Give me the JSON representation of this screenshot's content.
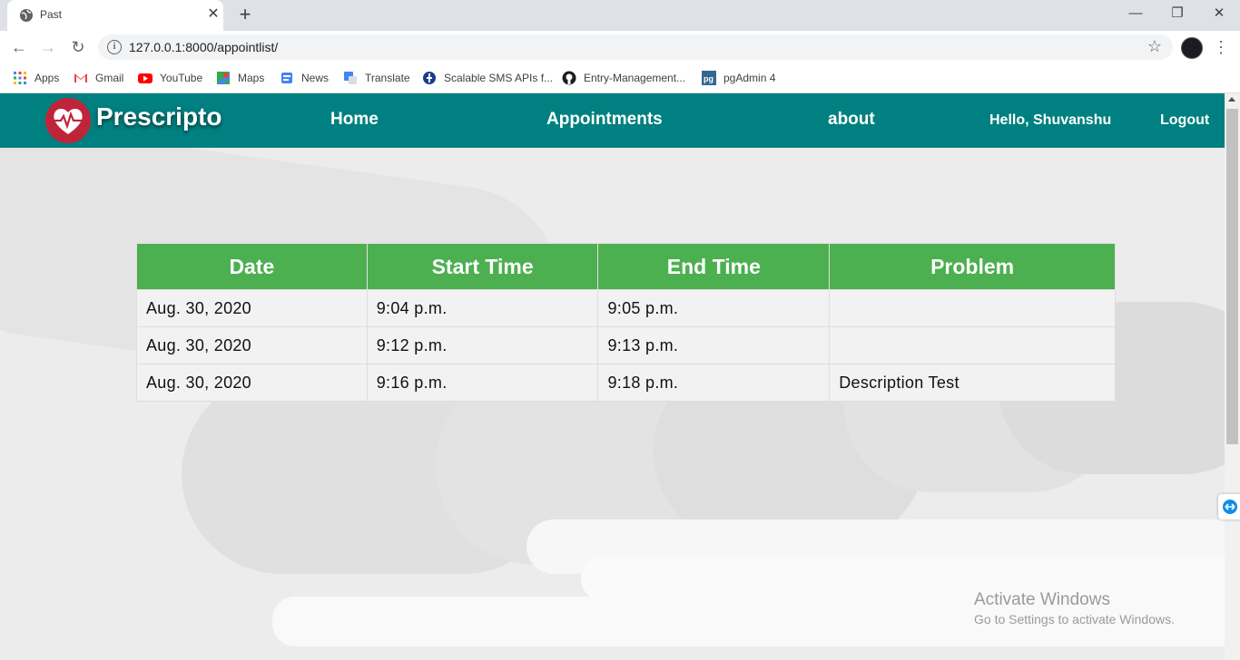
{
  "browser": {
    "tab_title": "Past",
    "url": "127.0.0.1:8000/appointlist/",
    "window_controls": {
      "minimize": "—",
      "restore": "❐",
      "close": "✕"
    },
    "bookmarks": [
      {
        "label": "Apps",
        "icon": "apps-grid-icon"
      },
      {
        "label": "Gmail",
        "icon": "gmail-icon"
      },
      {
        "label": "YouTube",
        "icon": "youtube-icon"
      },
      {
        "label": "Maps",
        "icon": "maps-icon"
      },
      {
        "label": "News",
        "icon": "news-icon"
      },
      {
        "label": "Translate",
        "icon": "translate-icon"
      },
      {
        "label": "Scalable SMS APIs f...",
        "icon": "twilio-icon"
      },
      {
        "label": "Entry-Management...",
        "icon": "github-icon"
      },
      {
        "label": "pgAdmin 4",
        "icon": "pgadmin-icon"
      }
    ]
  },
  "nav": {
    "brand": "Prescripto",
    "links": [
      "Home",
      "Appointments",
      "about"
    ],
    "greeting": "Hello, Shuvanshu",
    "logout": "Logout",
    "colors": {
      "bar": "#008080",
      "logo": "#c0243a"
    }
  },
  "table": {
    "headers": [
      "Date",
      "Start Time",
      "End Time",
      "Problem"
    ],
    "rows": [
      [
        "Aug. 30, 2020",
        "9:04 p.m.",
        "9:05 p.m.",
        ""
      ],
      [
        "Aug. 30, 2020",
        "9:12 p.m.",
        "9:13 p.m.",
        ""
      ],
      [
        "Aug. 30, 2020",
        "9:16 p.m.",
        "9:18 p.m.",
        "Description Test"
      ]
    ],
    "header_color": "#4caf50"
  },
  "watermark": {
    "line1": "Activate Windows",
    "line2": "Go to Settings to activate Windows."
  }
}
